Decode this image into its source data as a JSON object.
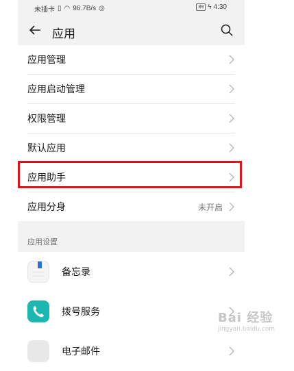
{
  "status_bar": {
    "carrier": "未插卡",
    "speed": "96.7B/s",
    "battery": "89",
    "time": "4:30"
  },
  "header": {
    "title": "应用"
  },
  "menu_items": [
    {
      "label": "应用管理"
    },
    {
      "label": "应用启动管理"
    },
    {
      "label": "权限管理"
    },
    {
      "label": "默认应用"
    },
    {
      "label": "应用助手"
    },
    {
      "label": "应用分身",
      "value": "未开启"
    }
  ],
  "app_settings": {
    "section_title": "应用设置",
    "apps": [
      {
        "label": "备忘录",
        "icon": "memo-icon"
      },
      {
        "label": "拨号服务",
        "icon": "phone-icon"
      },
      {
        "label": "电子邮件",
        "icon": "mail-icon"
      }
    ]
  },
  "watermark": {
    "text": "Bai 经验",
    "sub": "jingyan.baidu.com"
  },
  "colors": {
    "highlight": "#e0141b",
    "phone_icon": "#1bb7b0",
    "memo_flag": "#2f6fe0"
  }
}
